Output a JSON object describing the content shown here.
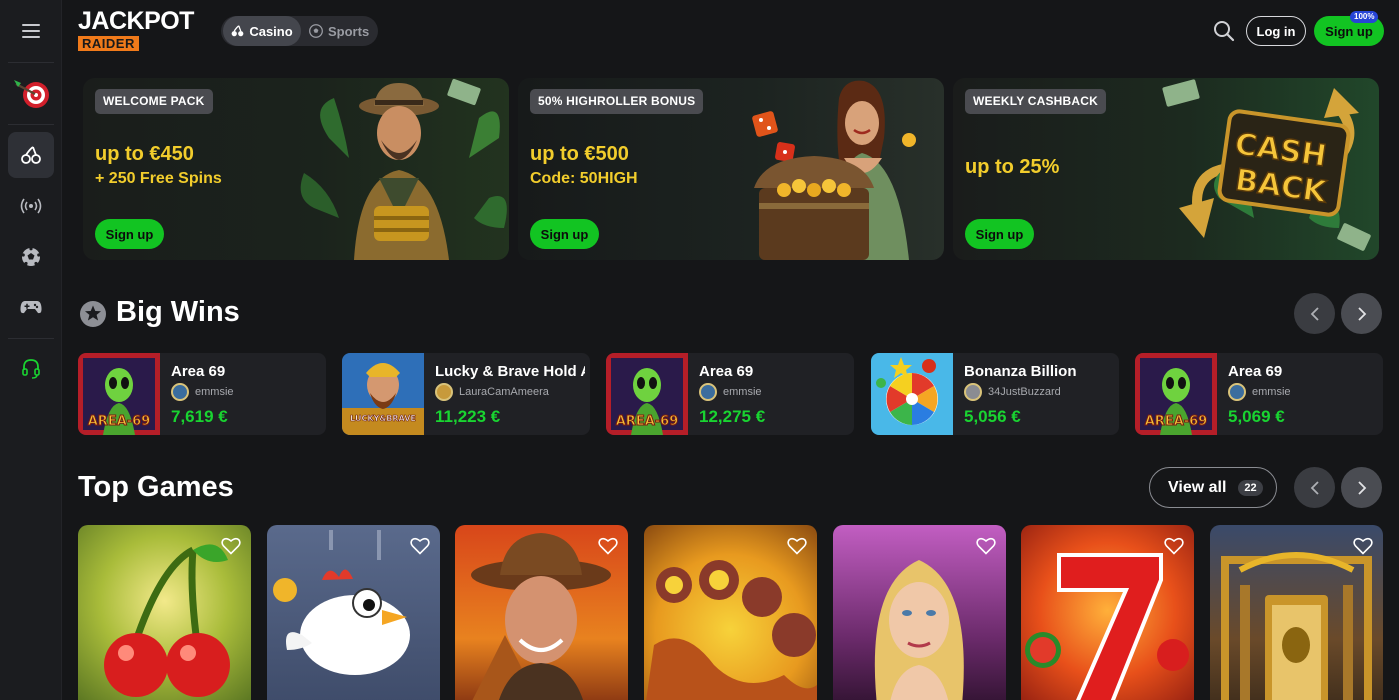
{
  "header": {
    "logo_top": "JACKPOT",
    "logo_bottom": "RAIDER",
    "tabs": [
      {
        "label": "Casino",
        "active": true
      },
      {
        "label": "Sports",
        "active": false
      }
    ],
    "login_label": "Log in",
    "signup_label": "Sign up",
    "signup_badge": "100%"
  },
  "sidebar": {
    "items": [
      {
        "icon": "menu-icon"
      },
      {
        "icon": "dart-target-icon"
      },
      {
        "icon": "cherry-icon",
        "active": true
      },
      {
        "icon": "live-broadcast-icon"
      },
      {
        "icon": "soccer-ball-icon"
      },
      {
        "icon": "gamepad-icon"
      },
      {
        "icon": "headset-support-icon"
      }
    ]
  },
  "promos": [
    {
      "badge": "WELCOME PACK",
      "amount": "up to €450",
      "sub": "+ 250 Free Spins",
      "cta": "Sign up"
    },
    {
      "badge": "50% HIGHROLLER BONUS",
      "amount": "up to €500",
      "sub": "Code: 50HIGH",
      "cta": "Sign up"
    },
    {
      "badge": "WEEKLY CASHBACK",
      "amount": "up to 25%",
      "sub": "",
      "cta": "Sign up",
      "art_text_1": "CASH",
      "art_text_2": "BACK"
    }
  ],
  "big_wins": {
    "title": "Big Wins",
    "items": [
      {
        "game": "Area 69",
        "user": "emmsie",
        "amount": "7,619 €",
        "thumb_text": "AREA-69"
      },
      {
        "game": "Lucky & Brave Hold A",
        "user": "LauraCamAmeera",
        "amount": "11,223 €",
        "thumb_text": "LUCKY&BRAVE"
      },
      {
        "game": "Area 69",
        "user": "emmsie",
        "amount": "12,275 €",
        "thumb_text": "AREA-69"
      },
      {
        "game": "Bonanza Billion",
        "user": "34JustBuzzard",
        "amount": "5,056 €",
        "thumb_text": ""
      },
      {
        "game": "Area 69",
        "user": "emmsie",
        "amount": "5,069 €",
        "thumb_text": "AREA-69"
      }
    ]
  },
  "top_games": {
    "title": "Top Games",
    "view_all_label": "View all",
    "count": "22",
    "items": [
      {
        "name": "cherry-slot"
      },
      {
        "name": "chicken-game"
      },
      {
        "name": "explorer-slot"
      },
      {
        "name": "oops-slot"
      },
      {
        "name": "blonde-lady-slot"
      },
      {
        "name": "lucky-seven-slot"
      },
      {
        "name": "egyptian-tomb-slot"
      }
    ]
  },
  "colors": {
    "accent_green": "#12c422",
    "win_green": "#19d431",
    "promo_yellow": "#f2cd2c",
    "logo_orange": "#f07a1a"
  }
}
